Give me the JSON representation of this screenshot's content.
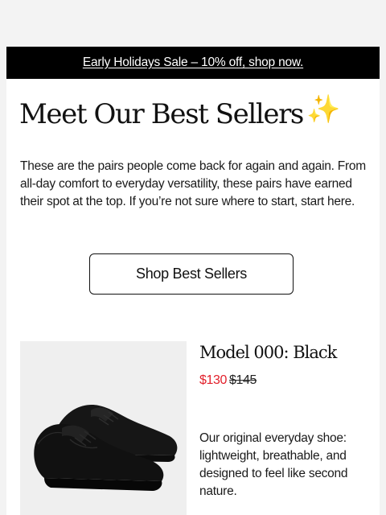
{
  "promo": {
    "text": "Early Holidays Sale – 10% off, shop now."
  },
  "hero": {
    "headline": "Meet Our Best Sellers",
    "headline_emoji": "✨",
    "intro": "These are the pairs people come back for again and again. From all-day comfort to everyday versatility, these pairs have earned their spot at the top. If you’re not sure where to start, start here.",
    "cta_label": "Shop Best Sellers"
  },
  "product": {
    "image_icon": "black-sneakers-image",
    "name": "Model 000: Black",
    "sale_price": "$130",
    "original_price": "$145",
    "description": "Our original everyday shoe: lightweight, breathable, and designed to feel like second nature."
  },
  "colors": {
    "page_background": "#f3f3f3",
    "email_background": "#ffffff",
    "promo_background": "#000000",
    "sale_price": "#e2202b",
    "image_background": "#efefef"
  }
}
